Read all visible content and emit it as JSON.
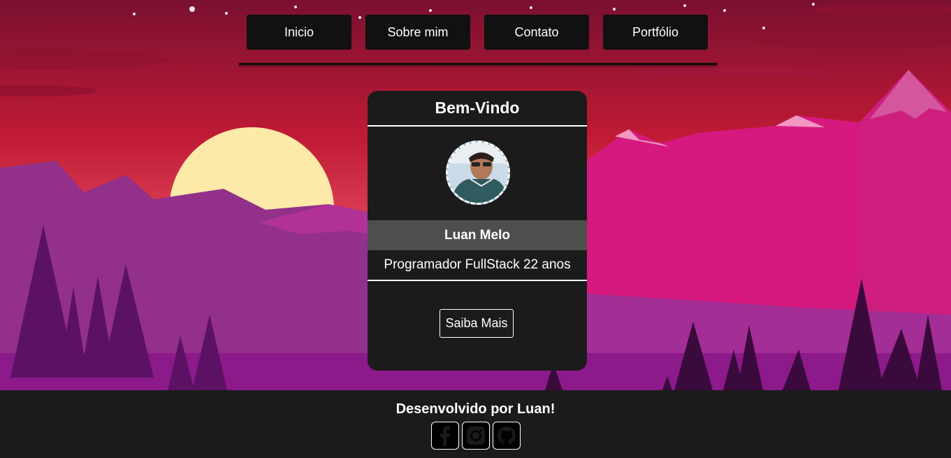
{
  "nav": {
    "items": [
      {
        "label": "Inicio"
      },
      {
        "label": "Sobre mim"
      },
      {
        "label": "Contato"
      },
      {
        "label": "Portfólio"
      }
    ]
  },
  "card": {
    "title": "Bem-Vindo",
    "name": "Luan Melo",
    "role": "Programador FullStack 22 anos",
    "button_label": "Saiba Mais"
  },
  "footer": {
    "text": "Desenvolvido por Luan!",
    "social_icons": [
      "facebook-icon",
      "instagram-icon",
      "github-icon"
    ]
  },
  "colors": {
    "sky_top": "#7a1030",
    "sky_mid": "#d4223a",
    "sun": "#fde9a8",
    "mountain_pink": "#d6197f",
    "mountain_purple": "#92308a",
    "card_bg": "#1b1b1b",
    "name_bar": "#4e4e4c",
    "footer_bg": "#1b1b1b"
  }
}
